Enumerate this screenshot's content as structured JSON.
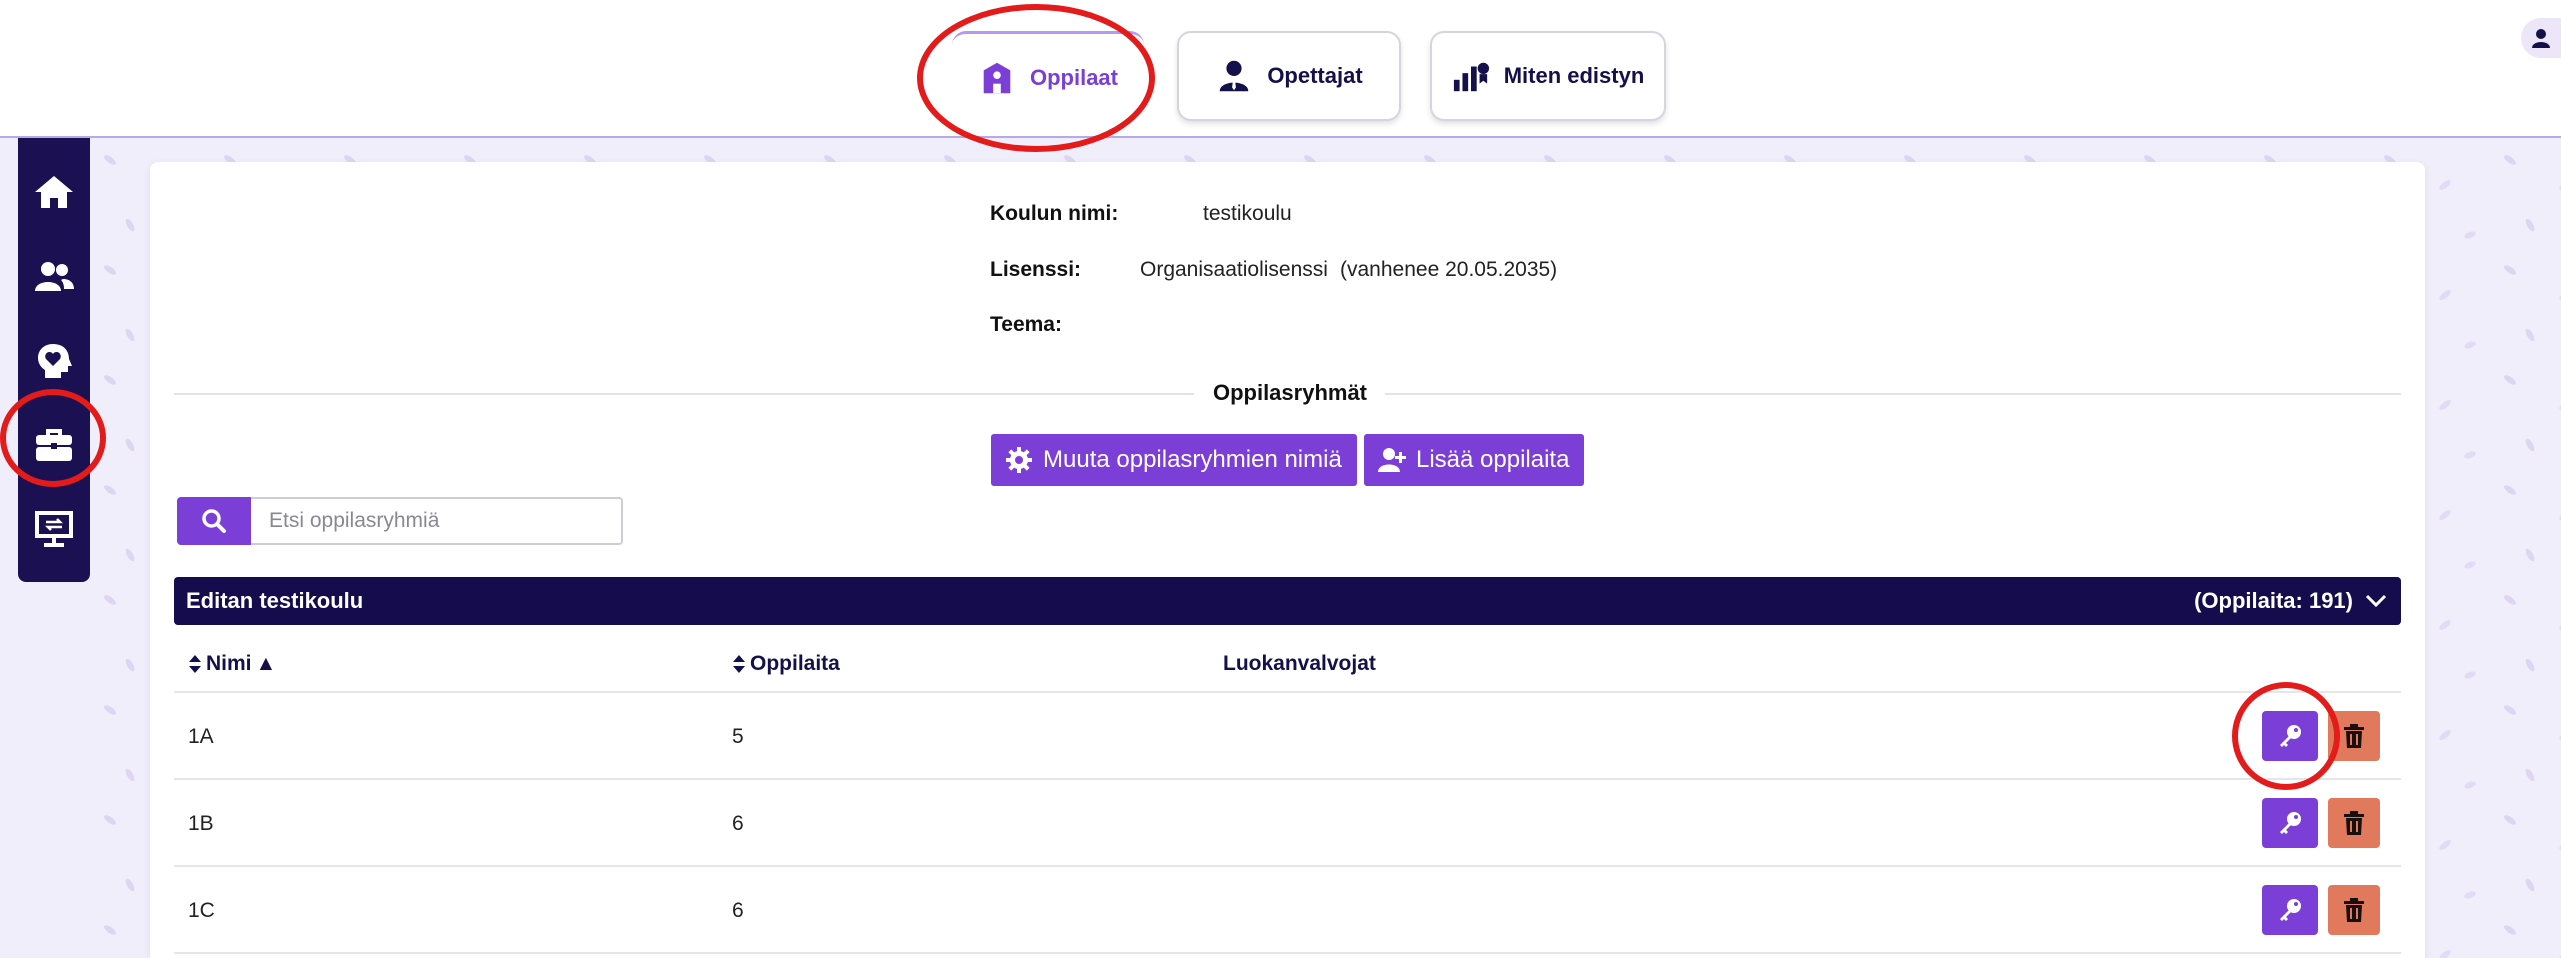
{
  "colors": {
    "accent": "#7b3fd8",
    "navy": "#140c4c",
    "danger": "#e17a5d",
    "annotation": "#e31b1b"
  },
  "top_tabs": [
    {
      "label": "Oppilaat",
      "icon": "school-icon",
      "active": true
    },
    {
      "label": "Opettajat",
      "icon": "teacher-icon",
      "active": false
    },
    {
      "label": "Miten edistyn",
      "icon": "progress-chart-icon",
      "active": false
    }
  ],
  "sidebar": {
    "items": [
      {
        "icon": "home-icon"
      },
      {
        "icon": "users-icon"
      },
      {
        "icon": "head-heart-icon"
      },
      {
        "icon": "briefcase-icon",
        "active": true
      },
      {
        "icon": "presentation-switch-icon"
      }
    ]
  },
  "school": {
    "name_label": "Koulun nimi:",
    "name_value": "testikoulu",
    "license_label": "Lisenssi:",
    "license_value": "Organisaatiolisenssi",
    "license_expiry": "(vanhenee 20.05.2035)",
    "theme_label": "Teema:"
  },
  "groups_section": {
    "title": "Oppilasryhmät",
    "rename_button": "Muuta oppilasryhmien nimiä",
    "add_students_button": "Lisää oppilaita",
    "search_placeholder": "Etsi oppilasryhmiä"
  },
  "group": {
    "name": "Editan testikoulu",
    "count_text": "(Oppilaita: 191)"
  },
  "table": {
    "headers": {
      "name": "Nimi",
      "name_sort_marker": "▲",
      "students": "Oppilaita",
      "supervisors": "Luokanvalvojat"
    },
    "rows": [
      {
        "name": "1A",
        "students": "5",
        "supervisors": ""
      },
      {
        "name": "1B",
        "students": "6",
        "supervisors": ""
      },
      {
        "name": "1C",
        "students": "6",
        "supervisors": ""
      }
    ]
  }
}
